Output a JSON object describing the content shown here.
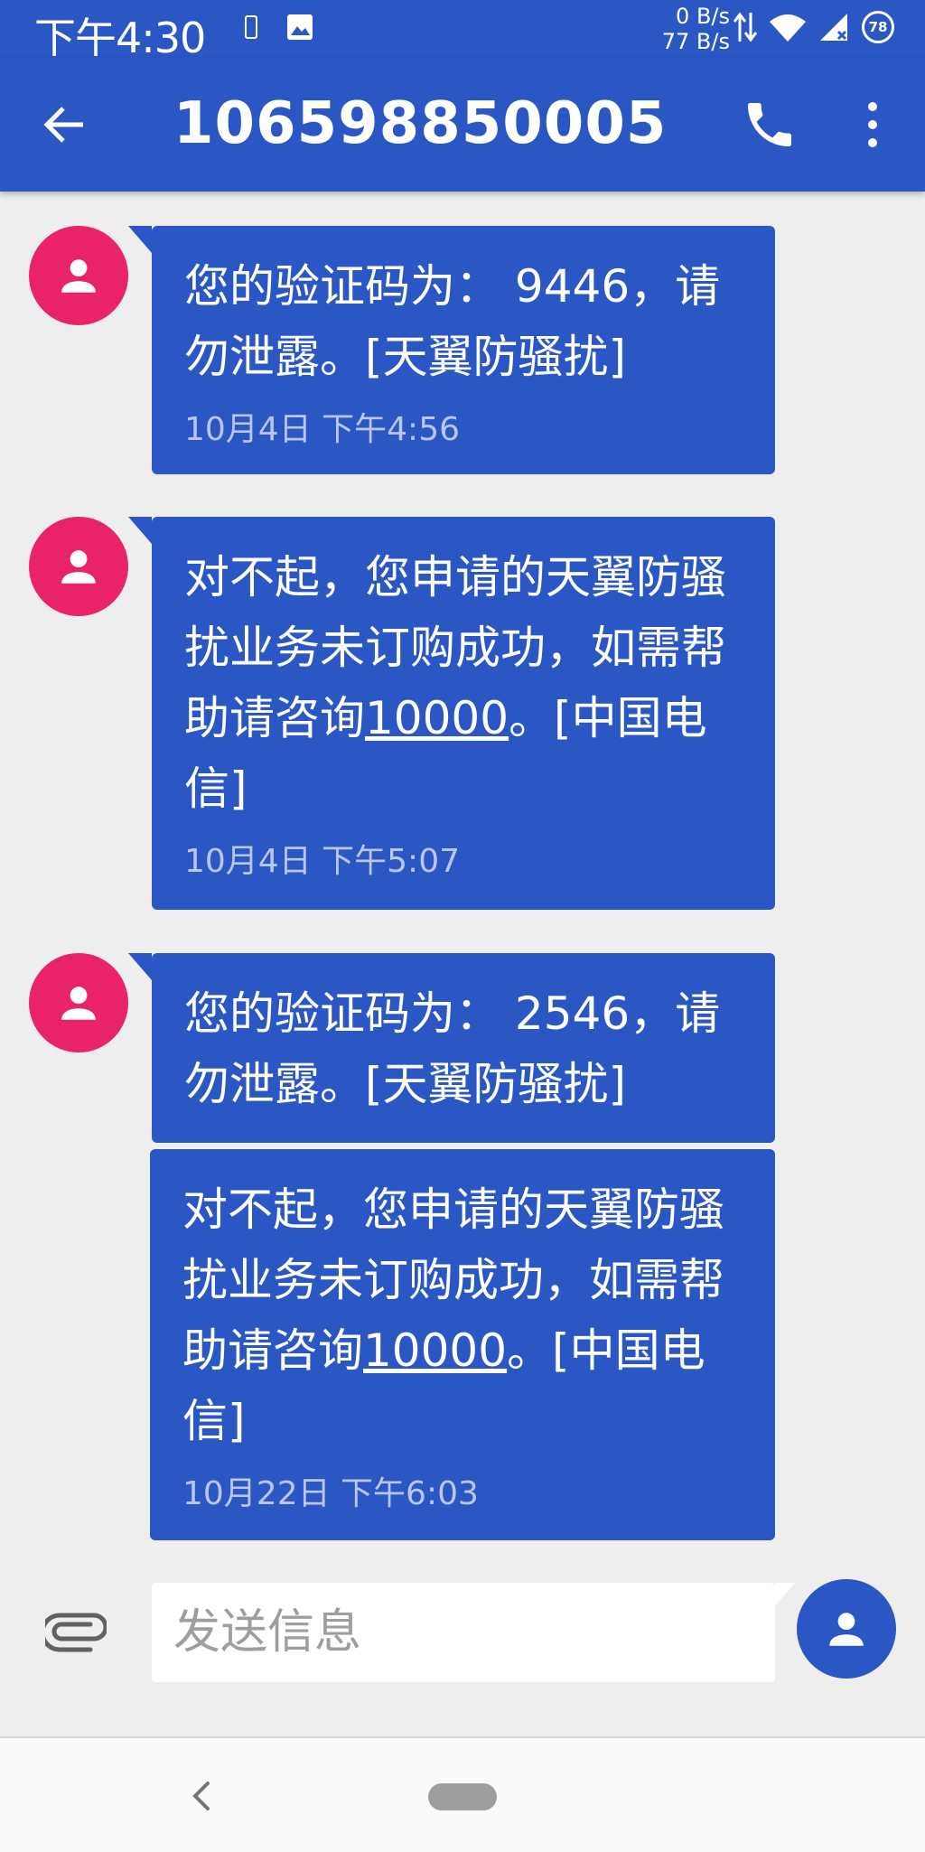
{
  "status_bar": {
    "time": "下午4:30",
    "net_down": "0 B/s",
    "net_up": "77 B/s",
    "battery": "78"
  },
  "header": {
    "title": "106598850005",
    "icons": [
      "back-arrow-icon",
      "phone-icon",
      "more-vert-icon"
    ]
  },
  "messages": [
    {
      "avatar_icon": "person-icon",
      "text": "您的验证码为： 9446，请勿泄露。[天翼防骚扰]",
      "time": "10月4日 下午4:56"
    },
    {
      "avatar_icon": "person-icon",
      "text_before_link": "对不起，您申请的天翼防骚扰业务未订购成功，如需帮助请咨询",
      "link": "10000",
      "text_after_link": "。[中国电信]",
      "time": "10月4日 下午5:07"
    },
    {
      "avatar_icon": "person-icon",
      "text": "您的验证码为： 2546，请勿泄露。[天翼防骚扰]"
    },
    {
      "text_before_link": "对不起，您申请的天翼防骚扰业务未订购成功，如需帮助请咨询",
      "link": "10000",
      "text_after_link": "。[中国电信]",
      "time": "10月22日 下午6:03"
    }
  ],
  "composer": {
    "placeholder": "发送信息",
    "attach_icon": "paperclip-icon",
    "send_icon": "person-icon"
  },
  "colors": {
    "primary": "#2b57c4",
    "avatar": "#e9236a",
    "background": "#eeeeee",
    "timestamp": "#b9c6ee"
  }
}
